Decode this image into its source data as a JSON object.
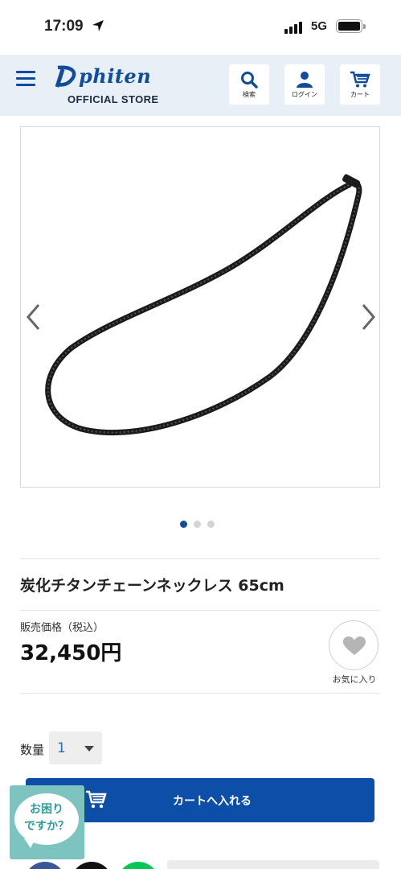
{
  "status_bar": {
    "time": "17:09",
    "network": "5G"
  },
  "header": {
    "logo_text": "phiten",
    "logo_subtitle": "OFFICIAL STORE",
    "buttons": [
      {
        "label": "検索",
        "icon": "search-icon"
      },
      {
        "label": "ログイン",
        "icon": "user-icon"
      },
      {
        "label": "カート",
        "icon": "cart-icon"
      }
    ]
  },
  "gallery": {
    "image_count": 3,
    "active_index": 1
  },
  "product": {
    "title": "炭化チタンチェーンネックレス 65cm",
    "price_label": "販売価格（税込）",
    "price": "32,450円",
    "favorite_label": "お気に入り"
  },
  "quantity": {
    "label": "数量",
    "value": "1"
  },
  "cart_button": {
    "label": "カートへ入れる"
  },
  "chat_widget": {
    "line1": "お困り",
    "line2": "ですか？"
  },
  "colors": {
    "brand": "#0f4c9e",
    "cart_button": "#0d4ea8",
    "header_bg": "#e9eff7",
    "chat_bg": "#7dc3bf"
  }
}
